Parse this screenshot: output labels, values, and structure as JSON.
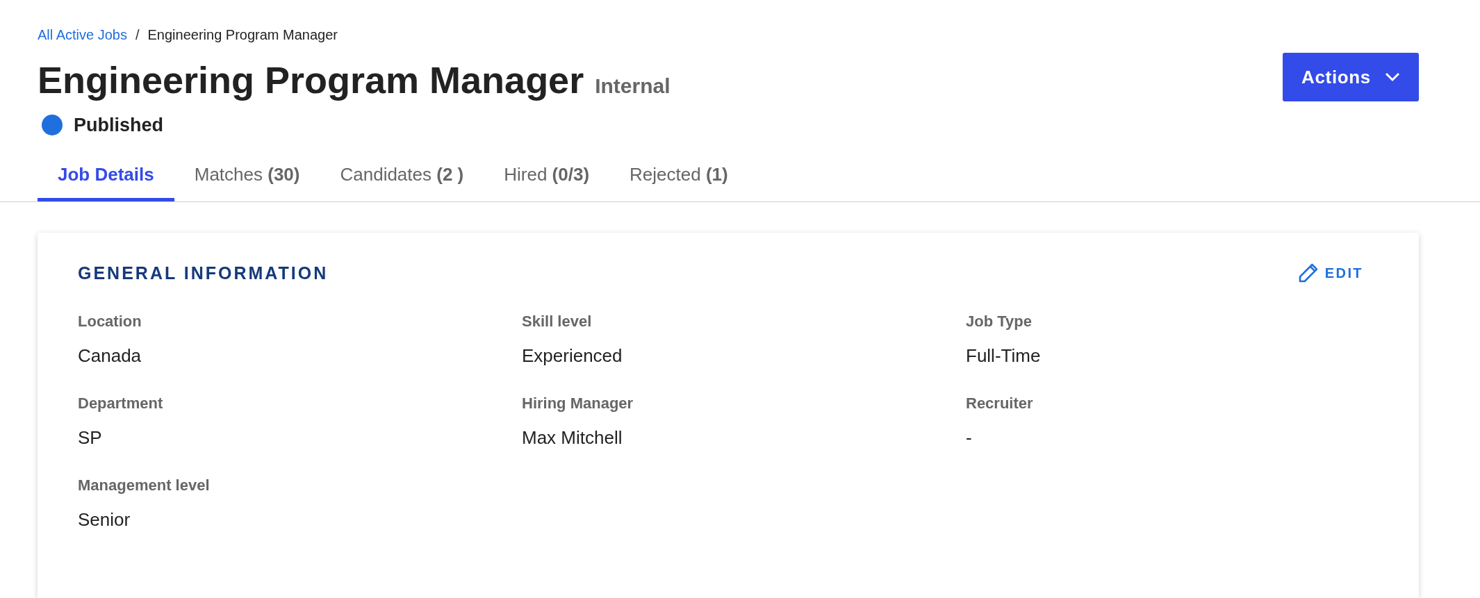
{
  "breadcrumb": [
    {
      "label": "All Active Jobs",
      "kind": "link"
    },
    {
      "label": "Engineering Program Manager",
      "kind": "current"
    }
  ],
  "breadcrumb_separator": "/",
  "title": "Engineering Program Manager",
  "badge": "Internal",
  "status": {
    "label": "Published",
    "color": "#1f6fde"
  },
  "actions_button": "Actions",
  "tabs": [
    {
      "label": "Job Details",
      "selected": true
    },
    {
      "label": "Matches **(30)**",
      "selected": false
    },
    {
      "label": "Candidates **(2 )**",
      "selected": false
    },
    {
      "label": "Hired **(0/3)**",
      "selected": false
    },
    {
      "label": "Rejected **(1)**",
      "selected": false
    }
  ],
  "card": {
    "title": "GENERAL INFORMATION",
    "edit_button": "EDIT",
    "fields": [
      {
        "label": "Location",
        "value": "Canada"
      },
      {
        "label": "Skill level",
        "value": "Experienced"
      },
      {
        "label": "Job Type",
        "value": "Full-Time"
      },
      {
        "label": "Department",
        "value": "SP"
      },
      {
        "label": "Hiring Manager",
        "value": "Max Mitchell"
      },
      {
        "label": "Recruiter",
        "value": "-"
      },
      {
        "label": "Management level",
        "value": "Senior"
      }
    ]
  }
}
